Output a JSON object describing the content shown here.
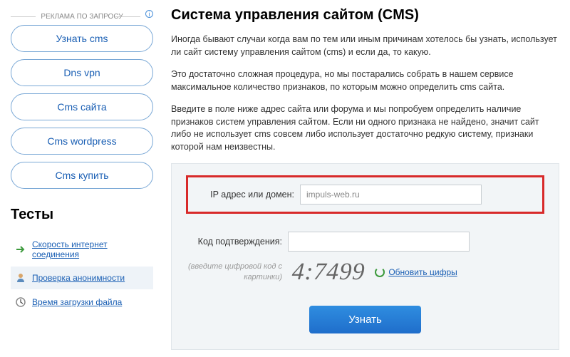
{
  "ads": {
    "header": "РЕКЛАМА ПО ЗАПРОСУ",
    "items": [
      "Узнать cms",
      "Dns vpn",
      "Cms сайта",
      "Cms wordpress",
      "Cms купить"
    ]
  },
  "tests": {
    "header": "Тесты",
    "items": [
      {
        "icon": "arrow-green",
        "label": "Скорость интернет соединения"
      },
      {
        "icon": "person",
        "label": "Проверка анонимности"
      },
      {
        "icon": "clock",
        "label": "Время загрузки файла"
      }
    ]
  },
  "page": {
    "title": "Система управления сайтом (CMS)",
    "p1": "Иногда бывают случаи когда вам по тем или иным причинам хотелось бы узнать, использует ли сайт систему управления сайтом (cms) и если да, то какую.",
    "p2": "Это достаточно сложная процедура, но мы постарались собрать в нашем сервисе максимальное количество признаков, по которым можно определить cms сайта.",
    "p3": "Введите в поле ниже адрес сайта или форума и мы попробуем определить наличие признаков систем управления сайтом. Если ни одного признака не найдено, значит сайт либо не использует cms совсем либо использует достаточно редкую систему, признаки которой нам неизвестны."
  },
  "form": {
    "domain_label": "IP адрес или домен:",
    "domain_value": "impuls-web.ru",
    "captcha_label": "Код подтверждения:",
    "captcha_hint": "(введите цифровой код с картинки)",
    "captcha_value": "4:7499",
    "refresh_label": "Обновить цифры",
    "submit_label": "Узнать"
  }
}
